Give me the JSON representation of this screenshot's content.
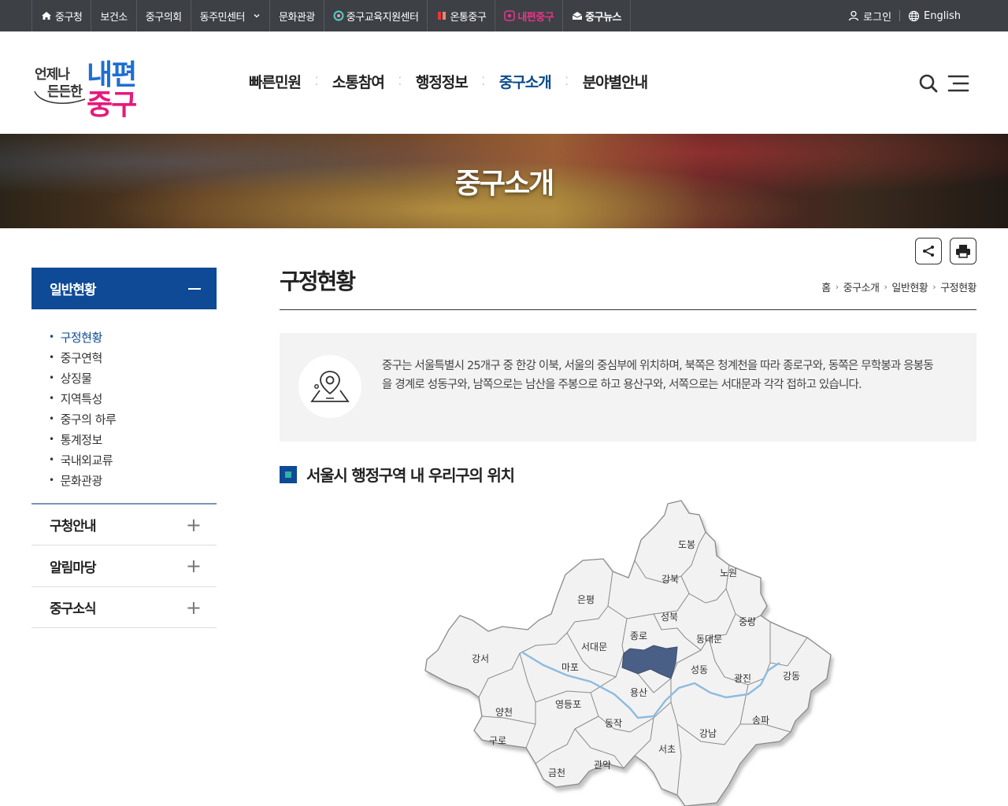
{
  "topbar": {
    "links": [
      {
        "label": "중구청",
        "icon": "home-icon"
      },
      {
        "label": "보건소"
      },
      {
        "label": "중구의회"
      },
      {
        "label": "동주민센터",
        "dropdown": true
      },
      {
        "label": "문화관광"
      },
      {
        "label": "중구교육지원센터",
        "icon": "education-logo-icon"
      },
      {
        "label": "온통중구",
        "icon": "ontong-logo-icon"
      },
      {
        "label": "내편중구",
        "icon": "naepyeon-logo-icon"
      },
      {
        "label": "중구뉴스",
        "icon": "news-icon"
      }
    ],
    "login": "로그인",
    "english": "English"
  },
  "logo": {
    "slogan_line1": "언제나",
    "slogan_line2": "든든한",
    "brand_line1": "내편",
    "brand_line2": "중구"
  },
  "gnb": {
    "items": [
      "빠른민원",
      "소통참여",
      "행정정보",
      "중구소개",
      "분야별안내"
    ],
    "active": "중구소개"
  },
  "banner": {
    "title": "중구소개"
  },
  "lnb": {
    "head": "일반현황",
    "sub_items": [
      "구정현황",
      "중구연혁",
      "상징물",
      "지역특성",
      "중구의 하루",
      "통계정보",
      "국내외교류",
      "문화관광"
    ],
    "active_sub": "구정현황",
    "groups": [
      "구청안내",
      "알림마당",
      "중구소식"
    ]
  },
  "content": {
    "page_title": "구정현황",
    "breadcrumb": [
      "홈",
      "중구소개",
      "일반현황",
      "구정현황"
    ],
    "intro_text": "중구는 서울특별시 25개구 중 한강 이북, 서울의 중심부에 위치하며, 북쪽은 청계천을 따라 종로구와, 동쪽은 무학봉과 응봉동을 경계로 성동구와, 남쪽으로는 남산을 주봉으로 하고 용산구와, 서쪽으로는 서대문과 각각 접하고 있습니다.",
    "section_title": "서울시 행정구역 내 우리구의 위치"
  },
  "map": {
    "districts": [
      "도봉",
      "노원",
      "강북",
      "은평",
      "성북",
      "중랑",
      "종로",
      "서대문",
      "동대문",
      "강서",
      "마포",
      "성동",
      "광진",
      "강동",
      "용산",
      "양천",
      "영등포",
      "동작",
      "강남",
      "송파",
      "구로",
      "서초",
      "금천",
      "관악"
    ],
    "highlight_color": "#4a5f86"
  }
}
